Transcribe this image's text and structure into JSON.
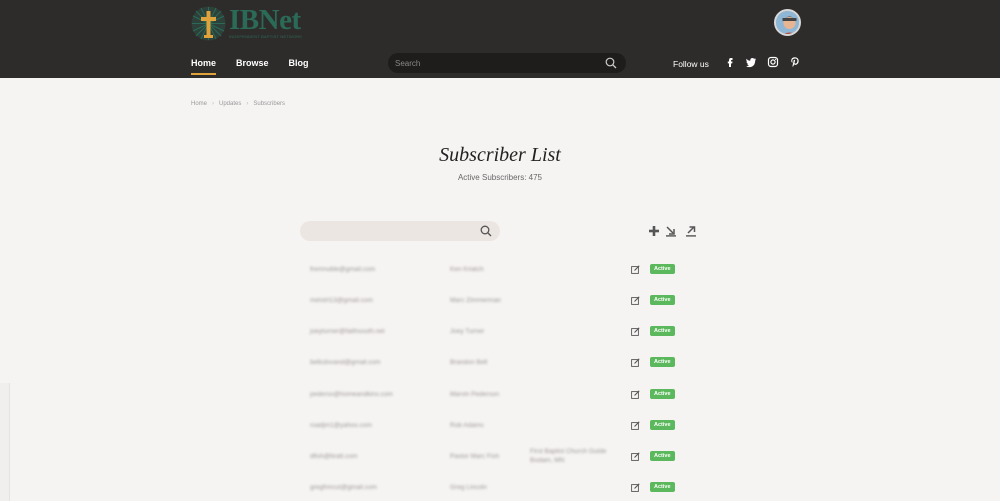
{
  "header": {
    "logo_name": "IBNet",
    "logo_tagline": "INDEPENDENT BAPTIST NETWORK",
    "nav": [
      {
        "label": "Home",
        "active": true
      },
      {
        "label": "Browse",
        "active": false
      },
      {
        "label": "Blog",
        "active": false
      }
    ],
    "search_placeholder": "Search",
    "follow_label": "Follow us",
    "social_icons": [
      "facebook-icon",
      "twitter-icon",
      "instagram-icon",
      "pinterest-icon"
    ]
  },
  "breadcrumb": [
    "Home",
    "Updates",
    "Subscribers"
  ],
  "page": {
    "title": "Subscriber List",
    "subtitle": "Active Subscribers: 475"
  },
  "list": {
    "search_placeholder": "",
    "rows": [
      {
        "email": "fremnuble@gmail.com",
        "name": "Ken Kriatch",
        "church": "",
        "status": "Active"
      },
      {
        "email": "melstrt13@gmail.com",
        "name": "Marc Zimmerman",
        "church": "",
        "status": "Active"
      },
      {
        "email": "joeyturner@faithsouth.net",
        "name": "Joey Turner",
        "church": "",
        "status": "Active"
      },
      {
        "email": "bellcdsvand@gmail.com",
        "name": "Brandon Bell",
        "church": "",
        "status": "Active"
      },
      {
        "email": "pederso@homeandkins.com",
        "name": "Marvin Pederson",
        "church": "",
        "status": "Active"
      },
      {
        "email": "roadjm1@yahoo.com",
        "name": "Rob Adams",
        "church": "",
        "status": "Active"
      },
      {
        "email": "dfish@bratt.com",
        "name": "Pastor Marc Fish",
        "church": "First Baptist Church Gulde Bodam, MN",
        "status": "Active"
      },
      {
        "email": "gregfnncut@gmail.com",
        "name": "Greg Lincoln",
        "church": "",
        "status": "Active"
      }
    ]
  },
  "colors": {
    "header_bg": "#2e2c2b",
    "accent": "#e0a23a",
    "brand_green": "#2a6a57",
    "badge_green": "#5cb85c"
  }
}
